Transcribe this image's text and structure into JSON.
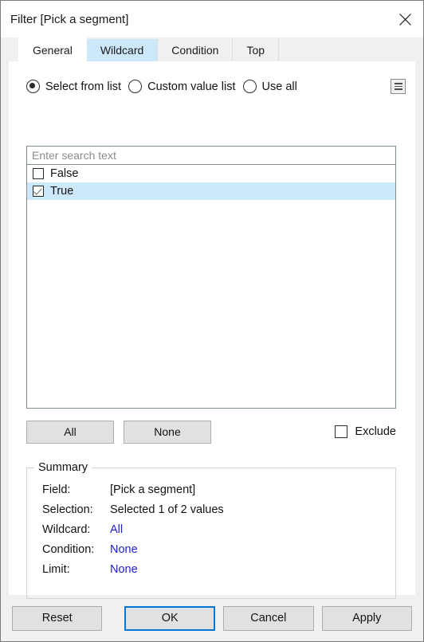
{
  "window": {
    "title": "Filter [Pick a segment]",
    "close_icon": "close-icon"
  },
  "tabs": [
    {
      "label": "General",
      "state": "active"
    },
    {
      "label": "Wildcard",
      "state": "hover"
    },
    {
      "label": "Condition",
      "state": "normal"
    },
    {
      "label": "Top",
      "state": "normal"
    }
  ],
  "mode_options": [
    {
      "label": "Select from list",
      "selected": true
    },
    {
      "label": "Custom value list",
      "selected": false
    },
    {
      "label": "Use all",
      "selected": false
    }
  ],
  "list_options_icon": "list-menu-icon",
  "search": {
    "placeholder": "Enter search text",
    "value": ""
  },
  "values": [
    {
      "label": "False",
      "checked": false,
      "selected": false
    },
    {
      "label": "True",
      "checked": true,
      "selected": true
    }
  ],
  "actions": {
    "all_label": "All",
    "none_label": "None",
    "exclude_label": "Exclude",
    "exclude_checked": false
  },
  "summary": {
    "legend": "Summary",
    "rows": [
      {
        "key": "Field:",
        "value": "[Pick a segment]",
        "link": false
      },
      {
        "key": "Selection:",
        "value": "Selected 1 of 2 values",
        "link": false
      },
      {
        "key": "Wildcard:",
        "value": "All",
        "link": true
      },
      {
        "key": "Condition:",
        "value": "None",
        "link": true
      },
      {
        "key": "Limit:",
        "value": "None",
        "link": true
      }
    ]
  },
  "footer": {
    "reset_label": "Reset",
    "ok_label": "OK",
    "cancel_label": "Cancel",
    "apply_label": "Apply"
  },
  "colors": {
    "accent": "#0078d7",
    "selection": "#cde8fa",
    "link": "#2222cc",
    "dialog_bg": "#f0f0f0"
  }
}
